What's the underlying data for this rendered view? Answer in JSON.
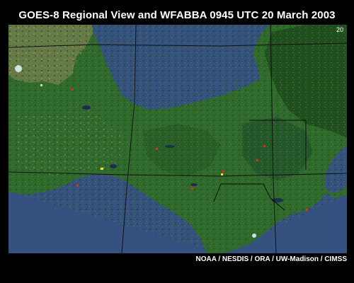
{
  "title": "GOES-8 Regional View and WFABBA  0945 UTC  20 March 2003",
  "frame_number": "20",
  "credit": "NOAA / NESDIS / ORA / UW-Madison / CIMSS",
  "colors": {
    "background": "#000000",
    "ocean": "#35517f",
    "land": "#2f6a2c",
    "dense_forest": "#1f4f1e",
    "dry_land": "#667a48",
    "grid_lines": "#111111",
    "fire_pixel": "#c0392b",
    "hotspot": "#f2e14a",
    "cloud": "#d7f2f1"
  }
}
